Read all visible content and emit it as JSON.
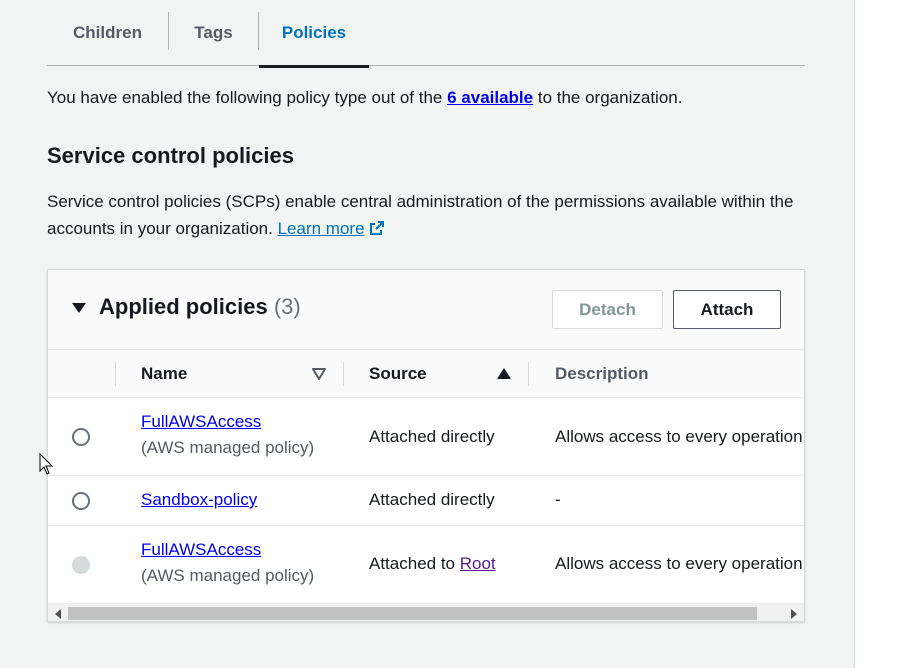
{
  "tabs": [
    {
      "label": "Children"
    },
    {
      "label": "Tags"
    },
    {
      "label": "Policies"
    }
  ],
  "intro": {
    "prefix": "You have enabled the following policy type out of the ",
    "link": "6 available",
    "suffix": " to the organization."
  },
  "section": {
    "title": "Service control policies",
    "description": "Service control policies (SCPs) enable central administration of the permissions available within the accounts in your organization. ",
    "learn_more": "Learn more"
  },
  "panel": {
    "title": "Applied policies",
    "count": "(3)",
    "detach_label": "Detach",
    "attach_label": "Attach"
  },
  "table": {
    "columns": [
      "Name",
      "Source",
      "Description"
    ],
    "rows": [
      {
        "name": "FullAWSAccess",
        "sub": "(AWS managed policy)",
        "source": "Attached directly",
        "source_link": "",
        "description": "Allows access to every operation",
        "disabled": false
      },
      {
        "name": "Sandbox-policy",
        "sub": "",
        "source": "Attached directly",
        "source_link": "",
        "description": "-",
        "disabled": false
      },
      {
        "name": "FullAWSAccess",
        "sub": "(AWS managed policy)",
        "source": "Attached to ",
        "source_link": "Root",
        "description": "Allows access to every operation",
        "disabled": true
      }
    ]
  },
  "colors": {
    "link": "#0000ee",
    "active_tab": "#0073bb",
    "visited_link": "#551a8b"
  }
}
